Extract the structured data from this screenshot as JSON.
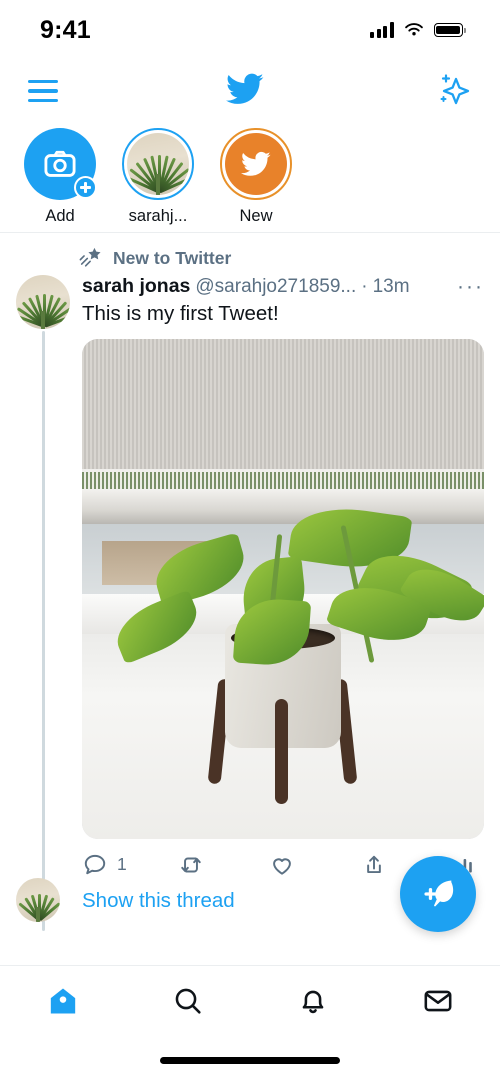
{
  "colors": {
    "twitter_blue": "#1DA1F2",
    "orange": "#E8822A",
    "text_primary": "#0F1419",
    "text_secondary": "#5B7083",
    "divider": "#EBEEF0"
  },
  "status_bar": {
    "time": "9:41",
    "signal_icon": "cellular-signal-icon",
    "wifi_icon": "wifi-icon",
    "battery_icon": "battery-full-icon"
  },
  "navbar": {
    "menu_icon": "hamburger-menu-icon",
    "logo_icon": "twitter-bird-logo-icon",
    "sparkle_icon": "sparkle-icon"
  },
  "fleets": [
    {
      "label": "Add",
      "type": "add",
      "icon": "camera-icon",
      "badge_icon": "plus-badge-icon"
    },
    {
      "label": "sarahj...",
      "type": "avatar",
      "icon": "plant-avatar"
    },
    {
      "label": "New",
      "type": "new",
      "icon": "twitter-bird-icon"
    }
  ],
  "tweet": {
    "context_label": "New to Twitter",
    "context_icon": "shooting-star-icon",
    "author_name": "sarah jonas",
    "author_handle": "@sarahjo271859...",
    "time_separator": "·",
    "timestamp": "13m",
    "more_icon": "···",
    "text": "This is my first Tweet!",
    "image_alt": "potted pothos plant on wooden stand by a window",
    "actions": [
      {
        "name": "reply",
        "icon": "reply-icon",
        "count": "1"
      },
      {
        "name": "retweet",
        "icon": "retweet-icon",
        "count": ""
      },
      {
        "name": "like",
        "icon": "heart-icon",
        "count": ""
      },
      {
        "name": "share",
        "icon": "share-icon",
        "count": ""
      },
      {
        "name": "analytics",
        "icon": "analytics-bars-icon",
        "count": ""
      }
    ],
    "show_thread_label": "Show this thread"
  },
  "compose_fab": {
    "icon": "compose-feather-plus-icon"
  },
  "tabbar": [
    {
      "name": "home",
      "icon": "home-icon",
      "active": true
    },
    {
      "name": "search",
      "icon": "search-icon",
      "active": false
    },
    {
      "name": "notifications",
      "icon": "bell-icon",
      "active": false
    },
    {
      "name": "messages",
      "icon": "envelope-icon",
      "active": false
    }
  ]
}
